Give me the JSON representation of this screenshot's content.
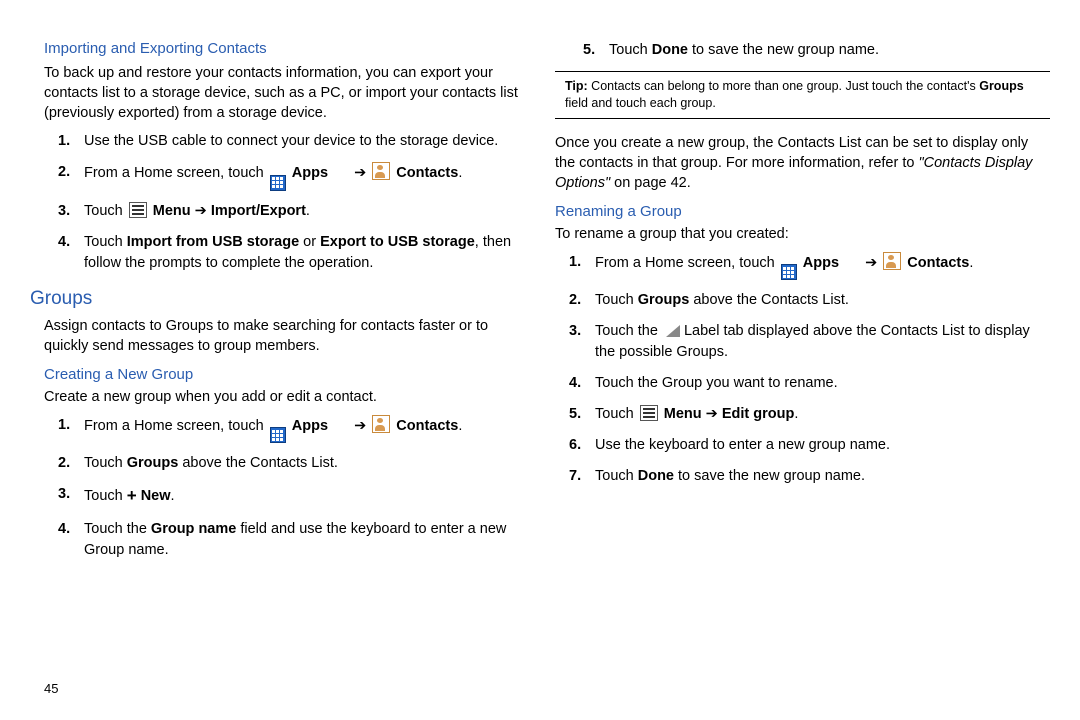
{
  "pageNumber": "45",
  "left": {
    "importHeading": "Importing and Exporting Contacts",
    "importIntro": "To back up and restore your contacts information, you can export your contacts list to a storage device, such as a PC, or import your contacts list (previously exported) from a storage device.",
    "importSteps": {
      "s1": "Use the USB cable to connect your device to the storage device.",
      "s2_a": "From a Home screen, touch ",
      "s2_apps": " Apps",
      "s2_contacts": "Contacts",
      "s3_a": "Touch ",
      "s3_menu": " Menu",
      "s3_arrow": " ➔ ",
      "s3_ie": "Import/Export",
      "s4_a": "Touch ",
      "s4_b": "Import from USB storage",
      "s4_c": " or ",
      "s4_d": "Export to USB storage",
      "s4_e": ", then follow the prompts to complete the operation."
    },
    "groupsHeading": "Groups",
    "groupsIntro": "Assign contacts to Groups to make searching for contacts faster or to quickly send messages to group members.",
    "createHeading": "Creating a New Group",
    "createIntro": "Create a new group when you add or edit a contact.",
    "createSteps": {
      "s1_a": "From a Home screen, touch ",
      "s1_apps": " Apps",
      "s1_contacts": "Contacts",
      "s2_a": "Touch ",
      "s2_b": "Groups",
      "s2_c": " above the Contacts List.",
      "s3_a": "Touch ",
      "s3_new": " New",
      "s4_a": "Touch the ",
      "s4_b": "Group name",
      "s4_c": " field and use the keyboard to enter a new Group name."
    }
  },
  "right": {
    "step5_a": "Touch ",
    "step5_b": "Done",
    "step5_c": " to save the new group name.",
    "tip_label": "Tip:",
    "tip_a": " Contacts can belong to more than one group. Just touch the contact's ",
    "tip_b": "Groups",
    "tip_c": " field and touch each group.",
    "afterTip_a": "Once you create a new group, the Contacts List can be set to display only the contacts in that group. For more information, refer to ",
    "afterTip_ref": "\"Contacts Display Options\"",
    "afterTip_b": " on page 42.",
    "renameHeading": "Renaming a Group",
    "renameIntro": "To rename a group that you created:",
    "renameSteps": {
      "s1_a": "From a Home screen, touch ",
      "s1_apps": " Apps",
      "s1_contacts": "Contacts",
      "s2_a": "Touch ",
      "s2_b": "Groups",
      "s2_c": " above the Contacts List.",
      "s3_a": "Touch the ",
      "s3_b": " Label tab displayed above the Contacts List to display the possible Groups.",
      "s4": "Touch the Group you want to rename.",
      "s5_a": "Touch ",
      "s5_menu": " Menu",
      "s5_arrow": " ➔ ",
      "s5_edit": "Edit group",
      "s6": "Use the keyboard to enter a new group name.",
      "s7_a": "Touch ",
      "s7_b": "Done",
      "s7_c": " to save the new group name."
    }
  }
}
